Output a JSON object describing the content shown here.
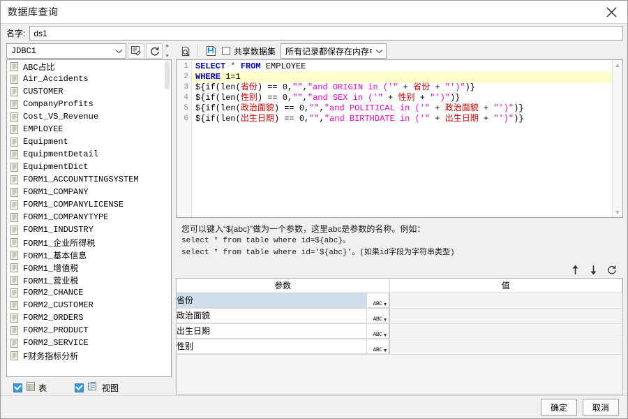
{
  "window": {
    "title": "数据库查询",
    "close_icon": "close-icon"
  },
  "name_row": {
    "label": "名字:",
    "value": "ds1",
    "placeholder": ""
  },
  "connection": {
    "selected": "JDBC1",
    "dropdown_icon": "chevron-down-icon",
    "edit_connection_icon": "edit-connection-icon",
    "refresh_icon": "refresh-icon"
  },
  "table_list": {
    "items": [
      "ABC占比",
      "Air_Accidents",
      "CUSTOMER",
      "CompanyProfits",
      "Cost_VS_Revenue",
      "EMPLOYEE",
      "Equipment",
      "EquipmentDetail",
      "EquipmentDict",
      "FORM1_ACCOUNTTINGSYSTEM",
      "FORM1_COMPANY",
      "FORM1_COMPANYLICENSE",
      "FORM1_COMPANYTYPE",
      "FORM1_INDUSTRY",
      "FORM1_企业所得税",
      "FORM1_基本信息",
      "FORM1_增值税",
      "FORM1_营业税",
      "FORM2_CHANCE",
      "FORM2_CUSTOMER",
      "FORM2_ORDERS",
      "FORM2_PRODUCT",
      "FORM2_SERVICE",
      "F财务指标分析"
    ],
    "item_icon": "table-icon"
  },
  "filters": {
    "table": {
      "label": "表",
      "checked": true,
      "icon": "table-icon"
    },
    "view": {
      "label": "视图",
      "checked": true,
      "icon": "view-icon"
    }
  },
  "sql_toolbar": {
    "preview_icon": "preview-icon",
    "save_icon": "save-dataset-icon",
    "shared_dataset": {
      "label": "共享数据集",
      "checked": false
    },
    "storage_mode": "所有记录都保存在内存中",
    "storage_dropdown_icon": "chevron-down-icon"
  },
  "sql_editor": {
    "line_numbers": [
      "1",
      "2",
      "3",
      "4",
      "5",
      "6"
    ],
    "highlighted_line": 2,
    "lines": [
      [
        {
          "t": "SELECT",
          "c": "kw"
        },
        {
          "t": " ",
          "c": "blk"
        },
        {
          "t": "*",
          "c": "op"
        },
        {
          "t": " ",
          "c": "blk"
        },
        {
          "t": "FROM",
          "c": "kw"
        },
        {
          "t": " EMPLOYEE",
          "c": "blk"
        }
      ],
      [
        {
          "t": "WHERE",
          "c": "kw"
        },
        {
          "t": " 1=1",
          "c": "blk"
        }
      ],
      [
        {
          "t": "${if(len(",
          "c": "blk"
        },
        {
          "t": "省份",
          "c": "red"
        },
        {
          "t": ") == 0,",
          "c": "blk"
        },
        {
          "t": "\"\"",
          "c": "pink"
        },
        {
          "t": ",",
          "c": "blk"
        },
        {
          "t": "\"and ORIGIN in ('\"",
          "c": "pink"
        },
        {
          "t": " + ",
          "c": "blk"
        },
        {
          "t": "省份",
          "c": "red"
        },
        {
          "t": " + ",
          "c": "blk"
        },
        {
          "t": "\"')\"",
          "c": "pink"
        },
        {
          "t": ")}",
          "c": "blk"
        }
      ],
      [
        {
          "t": "${if(len(",
          "c": "blk"
        },
        {
          "t": "性别",
          "c": "red"
        },
        {
          "t": ") == 0,",
          "c": "blk"
        },
        {
          "t": "\"\"",
          "c": "pink"
        },
        {
          "t": ",",
          "c": "blk"
        },
        {
          "t": "\"and SEX in ('\"",
          "c": "pink"
        },
        {
          "t": " + ",
          "c": "blk"
        },
        {
          "t": "性别",
          "c": "red"
        },
        {
          "t": " + ",
          "c": "blk"
        },
        {
          "t": "\"')\"",
          "c": "pink"
        },
        {
          "t": ")}",
          "c": "blk"
        }
      ],
      [
        {
          "t": "${if(len(",
          "c": "blk"
        },
        {
          "t": "政治面貌",
          "c": "red"
        },
        {
          "t": ") == 0,",
          "c": "blk"
        },
        {
          "t": "\"\"",
          "c": "pink"
        },
        {
          "t": ",",
          "c": "blk"
        },
        {
          "t": "\"and POLITICAL in ('\"",
          "c": "pink"
        },
        {
          "t": " + ",
          "c": "blk"
        },
        {
          "t": "政治面貌",
          "c": "red"
        },
        {
          "t": " + ",
          "c": "blk"
        },
        {
          "t": "\"')\"",
          "c": "pink"
        },
        {
          "t": ")}",
          "c": "blk"
        }
      ],
      [
        {
          "t": "${if(len(",
          "c": "blk"
        },
        {
          "t": "出生日期",
          "c": "red"
        },
        {
          "t": ") == 0,",
          "c": "blk"
        },
        {
          "t": "\"\"",
          "c": "pink"
        },
        {
          "t": ",",
          "c": "blk"
        },
        {
          "t": "\"and BIRTHDATE in ('\"",
          "c": "pink"
        },
        {
          "t": " + ",
          "c": "blk"
        },
        {
          "t": "出生日期",
          "c": "red"
        },
        {
          "t": " + ",
          "c": "blk"
        },
        {
          "t": "\"')\"",
          "c": "pink"
        },
        {
          "t": ")}",
          "c": "blk"
        }
      ]
    ]
  },
  "hint": {
    "line1": "您可以键入“${abc}”做为一个参数，这里abc是参数的名称。例如：",
    "line2": "select * from table where id=${abc}。",
    "line3": "select * from table where id='${abc}'。(如果id字段为字符串类型)"
  },
  "param_toolbar": {
    "move_up_icon": "arrow-up-icon",
    "move_down_icon": "arrow-down-icon",
    "refresh_icon": "refresh-icon"
  },
  "param_table": {
    "headers": [
      "参数",
      "值"
    ],
    "rows": [
      {
        "name": "省份",
        "type": "ABC",
        "value": "",
        "selected": true
      },
      {
        "name": "政治面貌",
        "type": "ABC",
        "value": "",
        "selected": false
      },
      {
        "name": "出生日期",
        "type": "ABC",
        "value": "",
        "selected": false
      },
      {
        "name": "性别",
        "type": "ABC",
        "value": "",
        "selected": false
      }
    ]
  },
  "footer": {
    "ok_label": "确定",
    "cancel_label": "取消"
  }
}
